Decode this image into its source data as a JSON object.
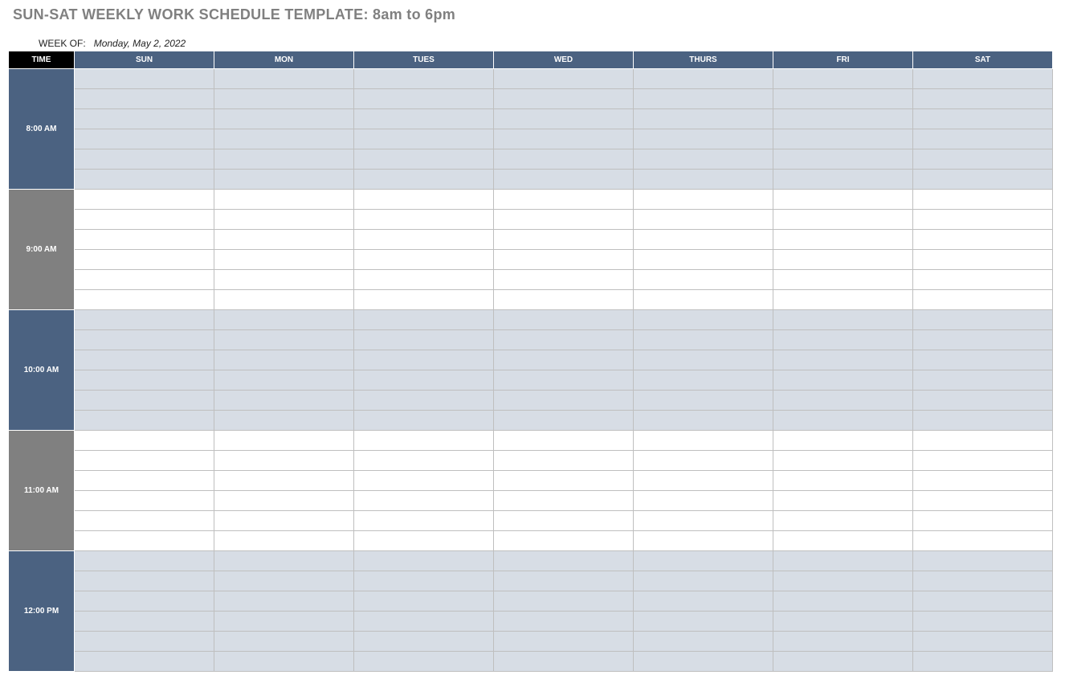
{
  "title": "SUN-SAT WEEKLY WORK SCHEDULE TEMPLATE: 8am to 6pm",
  "weekof_label": "WEEK OF:",
  "weekof_date": "Monday, May 2, 2022",
  "headers": {
    "time": "TIME",
    "days": [
      "SUN",
      "MON",
      "TUES",
      "WED",
      "THURS",
      "FRI",
      "SAT"
    ]
  },
  "time_blocks": [
    {
      "label": "8:00 AM",
      "style": "blue",
      "rows": 6
    },
    {
      "label": "9:00 AM",
      "style": "grey",
      "rows": 6
    },
    {
      "label": "10:00 AM",
      "style": "blue",
      "rows": 6
    },
    {
      "label": "11:00 AM",
      "style": "grey",
      "rows": 6
    },
    {
      "label": "12:00 PM",
      "style": "blue",
      "rows": 6
    }
  ]
}
